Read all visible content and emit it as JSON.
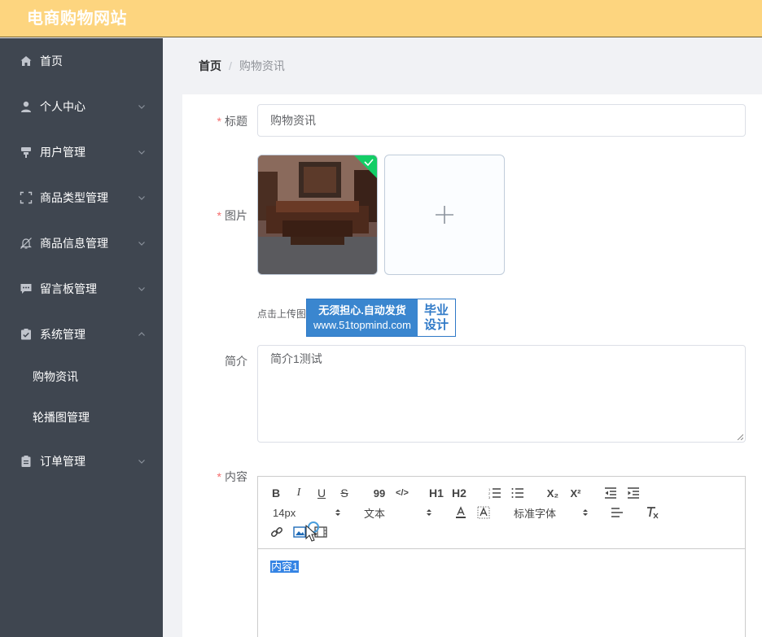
{
  "app": {
    "title": "电商购物网站"
  },
  "sidebar": {
    "items": [
      {
        "label": "首页",
        "icon": "home-icon"
      },
      {
        "label": "个人中心",
        "icon": "user-icon"
      },
      {
        "label": "用户管理",
        "icon": "user-manage-icon"
      },
      {
        "label": "商品类型管理",
        "icon": "scan-icon"
      },
      {
        "label": "商品信息管理",
        "icon": "bell-off-icon"
      },
      {
        "label": "留言板管理",
        "icon": "message-icon"
      },
      {
        "label": "系统管理",
        "icon": "check-icon"
      },
      {
        "label": "订单管理",
        "icon": "clipboard-icon"
      }
    ],
    "sub_items": [
      {
        "label": "购物资讯"
      },
      {
        "label": "轮播图管理"
      }
    ]
  },
  "breadcrumb": {
    "home": "首页",
    "separator": "/",
    "current": "购物资讯"
  },
  "form": {
    "title_label": "标题",
    "title_value": "购物资讯",
    "image_label": "图片",
    "upload_hint": "点击上传图",
    "summary_label": "简介",
    "summary_value": "简介1测试",
    "content_label": "内容",
    "required_mark": "*"
  },
  "watermark": {
    "line1": "无须担心.自动发货",
    "line2": "www.51topmind.com",
    "right1": "毕业",
    "right2": "设计"
  },
  "editor": {
    "font_size": "14px",
    "paragraph": "文本",
    "font_family": "标准字体",
    "content": "内容1",
    "buttons": {
      "bold": "B",
      "italic": "I",
      "underline": "U",
      "strike": "S",
      "quote": "99",
      "code": "</>",
      "h1": "H1",
      "h2": "H2",
      "sub": "X₂",
      "sup": "X²",
      "clean": "Tx"
    }
  },
  "colors": {
    "header": "#fdd57f",
    "sidebar": "#3f4650",
    "required": "#f56c6c",
    "selection": "#3584e4"
  }
}
